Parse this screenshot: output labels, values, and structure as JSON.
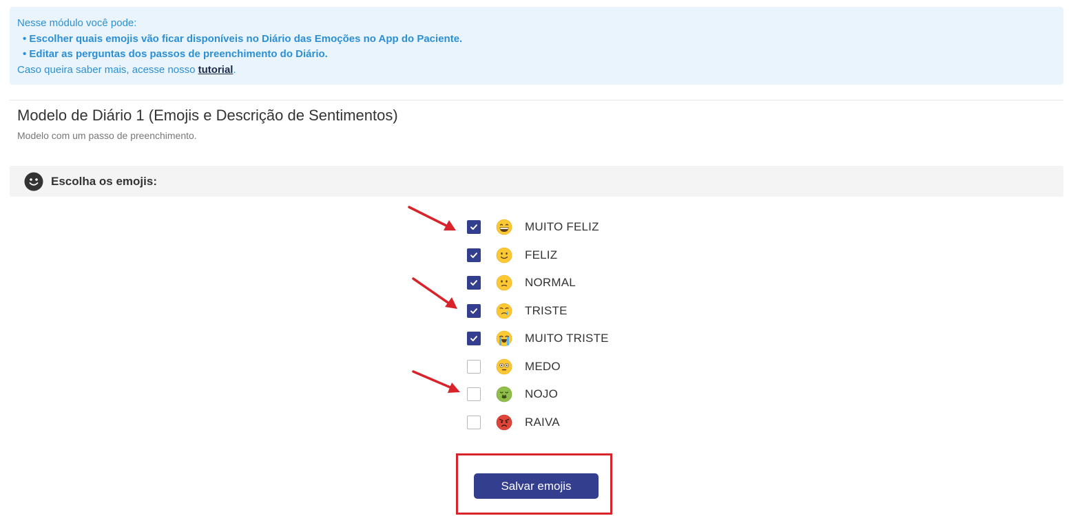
{
  "info": {
    "intro": "Nesse módulo você pode:",
    "bullets": [
      "• Escolher quais emojis vão ficar disponíveis no Diário das Emoções no App do Paciente.",
      "• Editar as perguntas dos passos de preenchimento do Diário."
    ],
    "more_prefix": "Caso queira saber mais, acesse nosso ",
    "tutorial_link": "tutorial",
    "more_suffix": "."
  },
  "model": {
    "title": "Modelo de Diário 1 (Emojis e Descrição de Sentimentos)",
    "subtitle": "Modelo com um passo de preenchimento."
  },
  "section": {
    "title": "Escolha os emojis:"
  },
  "emojis": [
    {
      "label": "MUITO FELIZ",
      "checked": true,
      "icon": "grinning-face-icon"
    },
    {
      "label": "FELIZ",
      "checked": true,
      "icon": "slightly-smiling-face-icon"
    },
    {
      "label": "NORMAL",
      "checked": true,
      "icon": "slightly-frowning-face-icon"
    },
    {
      "label": "TRISTE",
      "checked": true,
      "icon": "crying-face-icon"
    },
    {
      "label": "MUITO TRISTE",
      "checked": true,
      "icon": "loudly-crying-face-icon"
    },
    {
      "label": "MEDO",
      "checked": false,
      "icon": "flushed-face-icon"
    },
    {
      "label": "NOJO",
      "checked": false,
      "icon": "nauseated-face-icon"
    },
    {
      "label": "RAIVA",
      "checked": false,
      "icon": "angry-face-icon"
    }
  ],
  "save_button": "Salvar emojis",
  "colors": {
    "accent": "#333e8e",
    "info_text": "#2b8fd6",
    "info_bg": "#eaf4fd",
    "annotation": "#d9232a"
  }
}
